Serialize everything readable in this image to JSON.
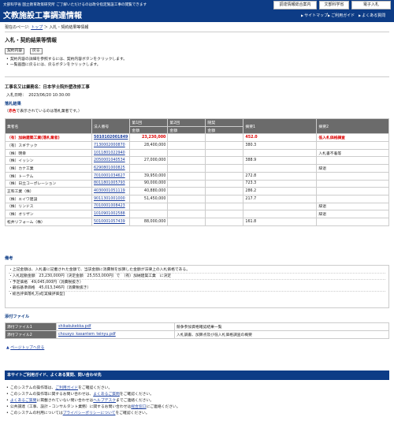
{
  "header": {
    "subtitle": "文部科学省 国立教育政策研究所 ご了解いただけるのは政令指定施設工事の閲覧できます",
    "title": "文教施設工事調達情報",
    "btn_shoukai": "調達情報総合案内",
    "btn_monka": "文部科学省",
    "btn_denshi": "電子入札",
    "nav_sitemap": "サイトマップ",
    "nav_guide": "ご利用ガイド",
    "nav_faq": "よくある質問"
  },
  "breadcrumb": {
    "prefix": "現在のページ:",
    "top": "トップ",
    "sep": "＞",
    "current": "入札・契約結果等情報"
  },
  "page_title": "入札・契約結果等情報",
  "buttons": {
    "contract": "契約内容",
    "back": "戻る"
  },
  "instructions": [
    "契約内容の詳細を参照するには、契約内容ボタンをクリックします。",
    "一覧画面に戻るには、戻るボタンをクリックします。"
  ],
  "project": {
    "title": "工事名又は業務名：日本学士院外壁改修工事",
    "date_label": "入札日時：",
    "date": "2023/06/20 10:30:00"
  },
  "results": {
    "section_title": "落札結果",
    "note_prefix": "（",
    "note_red": "赤色",
    "note_suffix": "で表示されているのは落札業者です。）",
    "headers": [
      "業者名",
      "法人番号",
      "第1回",
      "第2回",
      "随契",
      "摘要1",
      "摘要2"
    ],
    "subheaders": [
      "金額",
      "金額",
      "金額"
    ],
    "rows": [
      {
        "name": "（有）加納建築工業(落札業者)",
        "number": "5010102001849",
        "amt1": "23,230,000",
        "amt2": "",
        "zuikei": "",
        "tekiyo1": "452.0",
        "tekiyo2": "低入札価格調査",
        "winner": true
      },
      {
        "name": "（有）スギテック",
        "number": "7130002000870",
        "amt1": "28,400,000",
        "amt2": "",
        "zuikei": "",
        "tekiyo1": "380.3",
        "tekiyo2": "",
        "winner": false
      },
      {
        "name": "（株）明幸",
        "number": "1011801022940",
        "amt1": "",
        "amt2": "",
        "zuikei": "",
        "tekiyo1": "",
        "tekiyo2": "入札書不着等",
        "winner": false
      },
      {
        "name": "（株）イッシン",
        "number": "2050001040534",
        "amt1": "27,000,000",
        "amt2": "",
        "zuikei": "",
        "tekiyo1": "388.9",
        "tekiyo2": "",
        "winner": false
      },
      {
        "name": "（株）カナ工業",
        "number": "6290801000825",
        "amt1": "",
        "amt2": "",
        "zuikei": "",
        "tekiyo1": "",
        "tekiyo2": "辞退",
        "winner": false
      },
      {
        "name": "（株）トーテム",
        "number": "7010001034627",
        "amt1": "39,950,000",
        "amt2": "",
        "zuikei": "",
        "tekiyo1": "272.8",
        "tekiyo2": "",
        "winner": false
      },
      {
        "name": "（株）日立コーポレーション",
        "number": "8011801005793",
        "amt1": "90,000,000",
        "amt2": "",
        "zuikei": "",
        "tekiyo1": "723.3",
        "tekiyo2": "",
        "winner": false
      },
      {
        "name": "正和工業（株）",
        "number": "4030001051119",
        "amt1": "40,880,000",
        "amt2": "",
        "zuikei": "",
        "tekiyo1": "286.2",
        "tekiyo2": "",
        "winner": false
      },
      {
        "name": "（株）エイワ建設",
        "number": "9011301001000",
        "amt1": "51,450,000",
        "amt2": "",
        "zuikei": "",
        "tekiyo1": "217.7",
        "tekiyo2": "",
        "winner": false
      },
      {
        "name": "（株）リンドス",
        "number": "7010001008423",
        "amt1": "",
        "amt2": "",
        "zuikei": "",
        "tekiyo1": "",
        "tekiyo2": "辞退",
        "winner": false
      },
      {
        "name": "（株）オリザン",
        "number": "1010901002588",
        "amt1": "",
        "amt2": "",
        "zuikei": "",
        "tekiyo1": "",
        "tekiyo2": "辞退",
        "winner": false
      },
      {
        "name": "松井リフォーム（株）",
        "number": "5010001057439",
        "amt1": "88,000,000",
        "amt2": "",
        "zuikei": "",
        "tekiyo1": "161.8",
        "tekiyo2": "",
        "winner": false
      }
    ]
  },
  "remarks": {
    "section_title": "備考",
    "lines": [
      "・上記金額は、入札書に記載された金額で、当該金額に消費税を加算した金額が法律上の入札価格である。",
      "・入札起動金額　23,230,000円（決定金額　25,553,000円）で　（有）加納建築工業　に決定",
      "・予定価格　49,045,000円（消費税抜き）",
      "・最低基準価格　45,013,346円（消費税抜き）",
      "・総合評価落札方式[実績評価型]"
    ]
  },
  "attachments": {
    "section_title": "添付ファイル",
    "rows": [
      {
        "label": "添付ファイル1",
        "file": "shikakukekka.pdf",
        "desc": "競争参加資格確認結果一覧"
      },
      {
        "label": "添付ファイル2",
        "file": "chousyo_kasantem_teinyu.pdf",
        "desc": "入札調書、加算点及び低入札価格調査の概要"
      }
    ]
  },
  "page_top": "ページトップへ戻る",
  "footer": {
    "bar": "本サイトご利用ガイド、よくある質問、問い合わせ先",
    "lines": [
      [
        "このシステムの操作等は、",
        "ご利用ガイド",
        "をご確認ください。"
      ],
      [
        "このシステムの操作等に関するお問い合わせは、",
        "よくあるご質問",
        "をご確認ください。"
      ],
      [
        "",
        "よくあるご質問",
        "に掲載されていない問い合わせは",
        "ヘルプデスク",
        "までご連絡ください。"
      ],
      [
        "公共調達（工事、設計・コンサルタント業務）に関するお問い合わせは",
        "総合窓口",
        "にご連絡ください。"
      ],
      [
        "このシステムの利用については",
        "プライバシーポリシーについて",
        "をご確認ください。"
      ]
    ]
  }
}
